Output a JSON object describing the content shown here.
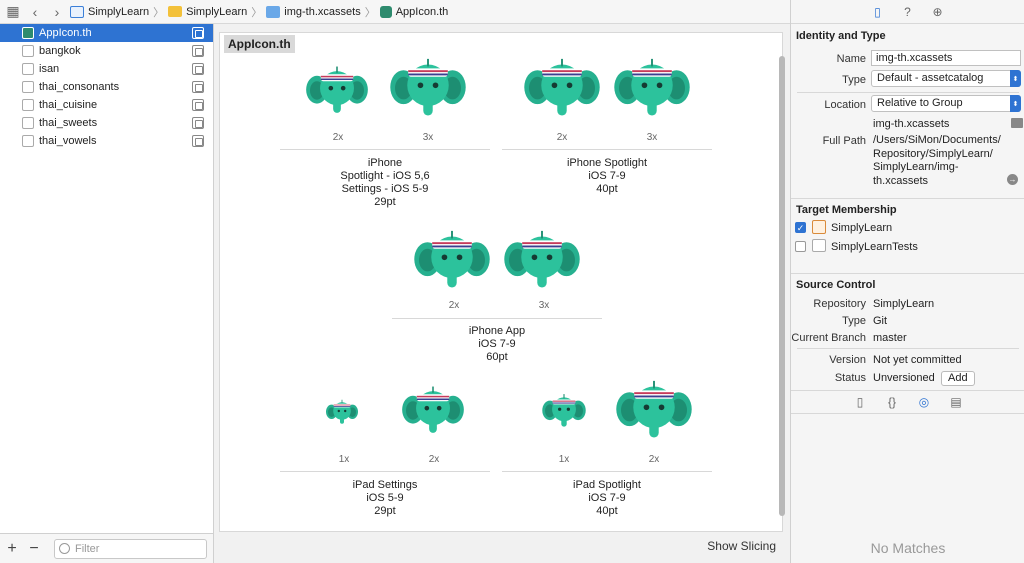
{
  "jumpbar": {
    "crumbs": [
      {
        "label": "SimplyLearn",
        "icon": "project-icon"
      },
      {
        "label": "SimplyLearn",
        "icon": "folder-icon"
      },
      {
        "label": "img-th.xcassets",
        "icon": "asset-catalog-icon"
      },
      {
        "label": "AppIcon.th",
        "icon": "appicon-icon"
      }
    ]
  },
  "navigator": {
    "items": [
      {
        "label": "AppIcon.th",
        "selected": true
      },
      {
        "label": "bangkok"
      },
      {
        "label": "isan"
      },
      {
        "label": "thai_consonants"
      },
      {
        "label": "thai_cuisine"
      },
      {
        "label": "thai_sweets"
      },
      {
        "label": "thai_vowels"
      }
    ],
    "filter_placeholder": "Filter"
  },
  "editor": {
    "title": "AppIcon.th",
    "show_slicing": "Show Slicing",
    "groups": [
      {
        "lines": [
          "iPhone",
          "Spotlight - iOS 5,6",
          "Settings - iOS 5-9",
          "29pt"
        ],
        "scales": [
          "2x",
          "3x"
        ]
      },
      {
        "lines": [
          "iPhone Spotlight",
          "iOS 7-9",
          "40pt"
        ],
        "scales": [
          "2x",
          "3x"
        ]
      },
      {
        "lines": [
          "iPhone App",
          "iOS 7-9",
          "60pt"
        ],
        "scales": [
          "2x",
          "3x"
        ]
      },
      {
        "lines": [
          "iPad Settings",
          "iOS 5-9",
          "29pt"
        ],
        "scales": [
          "1x",
          "2x"
        ]
      },
      {
        "lines": [
          "iPad Spotlight",
          "iOS 7-9",
          "40pt"
        ],
        "scales": [
          "1x",
          "2x"
        ]
      }
    ]
  },
  "inspector": {
    "identity_header": "Identity and Type",
    "name_label": "Name",
    "name_value": "img-th.xcassets",
    "type_label": "Type",
    "type_value": "Default - assetcatalog",
    "location_label": "Location",
    "location_value": "Relative to Group",
    "location_path": "img-th.xcassets",
    "fullpath_label": "Full Path",
    "fullpath_value": [
      "/Users/SiMon/Documents/",
      "Repository/SimplyLearn/",
      "SimplyLearn/img-",
      "th.xcassets"
    ],
    "target_header": "Target Membership",
    "targets": [
      {
        "label": "SimplyLearn",
        "checked": true
      },
      {
        "label": "SimplyLearnTests",
        "checked": false
      }
    ],
    "source_header": "Source Control",
    "repository_label": "Repository",
    "repository_value": "SimplyLearn",
    "sc_type_label": "Type",
    "sc_type_value": "Git",
    "branch_label": "Current Branch",
    "branch_value": "master",
    "version_label": "Version",
    "version_value": "Not yet committed",
    "status_label": "Status",
    "status_value": "Unversioned",
    "add_label": "Add",
    "no_matches": "No Matches"
  },
  "colors": {
    "selection": "#2e73d2",
    "elephant": "#26b08f",
    "elephant_dark": "#1d8e72"
  }
}
